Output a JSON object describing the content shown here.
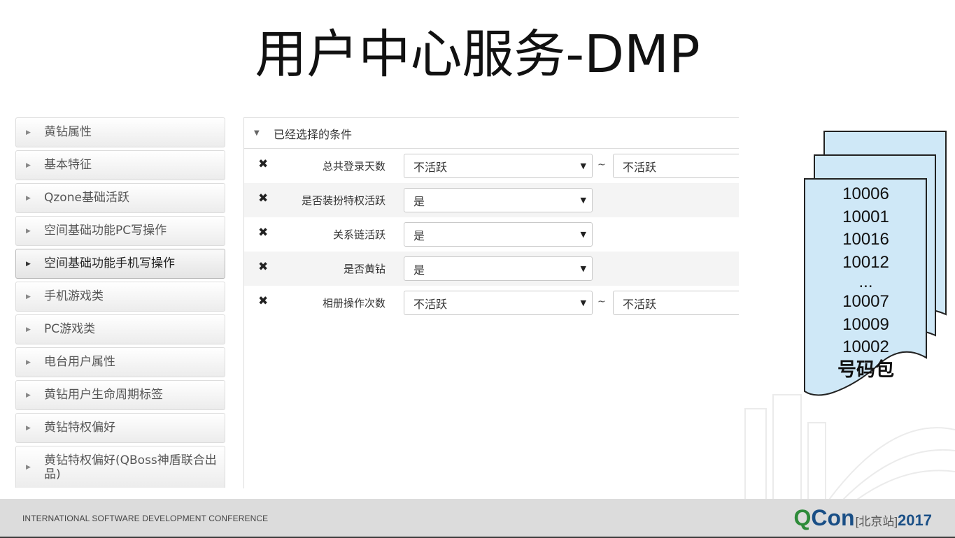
{
  "title": "用户中心服务-DMP",
  "sidebar": {
    "items": [
      {
        "label": "黄钻属性"
      },
      {
        "label": "基本特征"
      },
      {
        "label": "Qzone基础活跃"
      },
      {
        "label": "空间基础功能PC写操作"
      },
      {
        "label": "空间基础功能手机写操作"
      },
      {
        "label": "手机游戏类"
      },
      {
        "label": "PC游戏类"
      },
      {
        "label": "电台用户属性"
      },
      {
        "label": "黄钻用户生命周期标签"
      },
      {
        "label": "黄钻特权偏好"
      },
      {
        "label": "黄钻特权偏好(QBoss神盾联合出品)"
      }
    ]
  },
  "panel": {
    "header": "已经选择的条件",
    "conditions": [
      {
        "label": "总共登录天数",
        "value": "不活跃",
        "range_to": "不活跃",
        "tilde": "~"
      },
      {
        "label": "是否装扮特权活跃",
        "value": "是"
      },
      {
        "label": "关系链活跃",
        "value": "是"
      },
      {
        "label": "是否黄钻",
        "value": "是"
      },
      {
        "label": "相册操作次数",
        "value": "不活跃",
        "range_to": "不活跃",
        "tilde": "~"
      }
    ]
  },
  "number_package": {
    "numbers": [
      "10006",
      "10001",
      "10016",
      "10012",
      "...",
      "10007",
      "10009",
      "10002"
    ],
    "label": "号码包"
  },
  "footer": {
    "conference": "INTERNATIONAL SOFTWARE DEVELOPMENT CONFERENCE",
    "logo_q": "Q",
    "logo_con": "Con",
    "logo_city": "[北京站]",
    "logo_year": "2017"
  },
  "colors": {
    "doc_fill": "#cfe8f7",
    "logo_green": "#2e8b3a",
    "logo_blue": "#1a4f86"
  },
  "icons": {
    "sidebar_expand": "triangle-right-icon",
    "panel_collapse": "triangle-down-icon",
    "remove": "close-icon",
    "dropdown": "triangle-down-icon"
  }
}
